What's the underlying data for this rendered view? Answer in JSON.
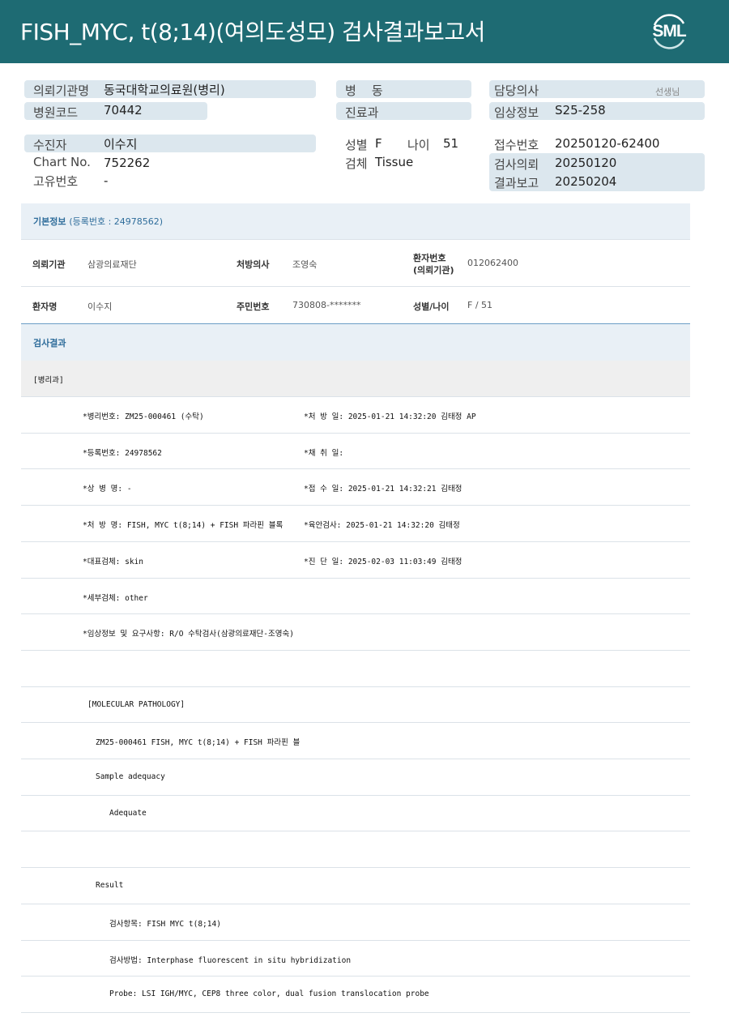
{
  "header": {
    "title": "FISH_MYC,  t(8;14)(여의도성모) 검사결과보고서",
    "logo": "SML"
  },
  "summary": {
    "institution_label": "의뢰기관명",
    "institution_value": "동국대학교의료원(병리)",
    "hospital_code_label": "병원코드",
    "hospital_code_value": "70442",
    "ward_label": "병    동",
    "department_label": "진료과",
    "doctor_label": "담당의사",
    "doctor_suffix": "선생님",
    "clinical_label": "임상정보",
    "clinical_value": "S25-258",
    "patient_label": "수진자",
    "patient_value": "이수지",
    "chart_label": "Chart No.",
    "chart_value": "752262",
    "unique_label": "고유번호",
    "unique_value": "-",
    "sex_label": "성별",
    "sex_value": "F",
    "age_label": "나이",
    "age_value": "51",
    "specimen_label": "검체",
    "specimen_value": "Tissue",
    "receipt_label": "접수번호",
    "receipt_value": "20250120-62400",
    "request_label": "검사의뢰",
    "request_value": "20250120",
    "report_label": "결과보고",
    "report_value": "20250204"
  },
  "basic_info": {
    "title": "기본정보",
    "reg_text": "(등록번호 : 24978562)",
    "rows": [
      {
        "k1": "의뢰기관",
        "v1": "삼광의료재단",
        "k2": "처방의사",
        "v2": "조영숙",
        "k3a": "환자번호",
        "k3b": "(의뢰기관)",
        "v3": "012062400"
      },
      {
        "k1": "환자명",
        "v1": "이수지",
        "k2": "주민번호",
        "v2": "730808-*******",
        "k3": "성별/나이",
        "v3": "F / 51"
      }
    ]
  },
  "results": {
    "title": "검사결과",
    "dept": "[병리과]",
    "lines": [
      {
        "left": "*병리번호: ZM25-000461 (수탁)",
        "right": "*처 방 일: 2025-01-21 14:32:20  김태정 AP"
      },
      {
        "left": "*등록번호: 24978562",
        "right": "*채 취 일:"
      },
      {
        "left": "*상 병 명: -",
        "right": "*접 수 일: 2025-01-21 14:32:21  김태정"
      },
      {
        "left": "*처 방 명: FISH, MYC t(8;14) + FISH 파라핀 블록",
        "right": "*육안검사: 2025-01-21 14:32:20  김태정"
      },
      {
        "left": "*대표검체: skin",
        "right": "*진 단 일: 2025-02-03 11:03:49  김태정"
      },
      {
        "left": "*세부검체: other",
        "right": ""
      },
      {
        "left": "*임상정보 및 요구사항: R/O 수탁검사(삼광의료재단-조영숙)",
        "right": ""
      },
      {
        "left": "",
        "right": ""
      },
      {
        "left": "[MOLECULAR PATHOLOGY]",
        "right": ""
      },
      {
        "left": "ZM25-000461     FISH, MYC t(8;14) + FISH 파라핀 블",
        "right": ""
      },
      {
        "left": "Sample adequacy",
        "right": ""
      },
      {
        "left": "Adequate",
        "right": ""
      },
      {
        "left": "",
        "right": ""
      },
      {
        "left": "Result",
        "right": ""
      },
      {
        "left": "검사항목: FISH MYC t(8;14)",
        "right": ""
      },
      {
        "left": "검사방법: Interphase fluorescent in situ hybridization",
        "right": ""
      },
      {
        "left": "Probe: LSI IGH/MYC, CEP8 three color, dual fusion translocation probe",
        "right": ""
      }
    ]
  }
}
